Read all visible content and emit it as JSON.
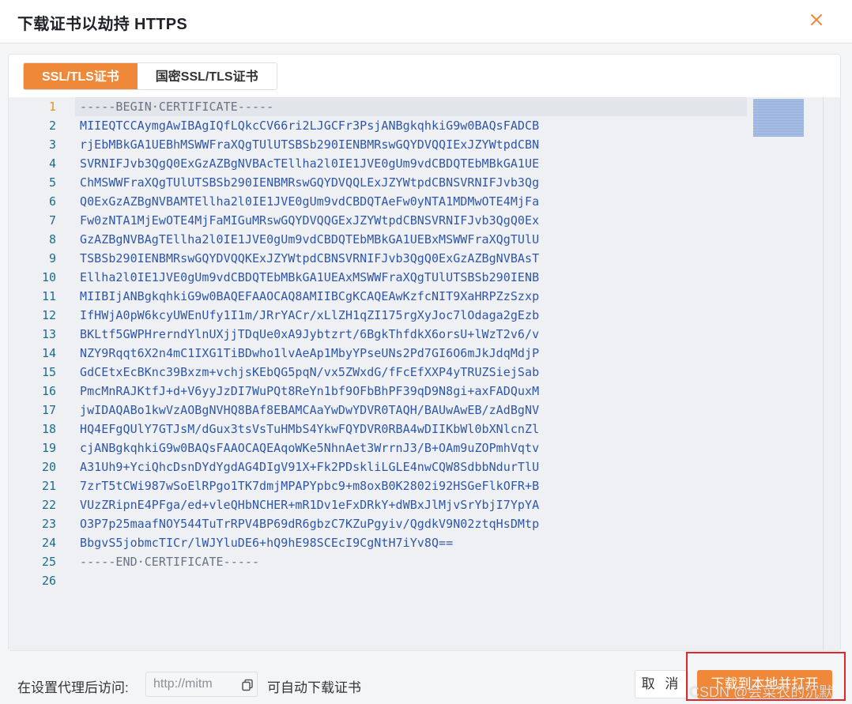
{
  "dialog": {
    "title": "下载证书以劫持 HTTPS",
    "close_icon": "close-icon"
  },
  "tabs": [
    {
      "label": "SSL/TLS证书",
      "active": true
    },
    {
      "label": "国密SSL/TLS证书",
      "active": false
    }
  ],
  "editor": {
    "active_line": 1,
    "lines": [
      {
        "n": "1",
        "text": "-----BEGIN·CERTIFICATE-----"
      },
      {
        "n": "2",
        "text": "MIIEQTCCAymgAwIBAgIQfLQkcCV66ri2LJGCFr3PsjANBgkqhkiG9w0BAQsFADCB"
      },
      {
        "n": "3",
        "text": "rjEbMBkGA1UEBhMSWWFraXQgTUlUTSBSb290IENBMRswGQYDVQQIExJZYWtpdCBN"
      },
      {
        "n": "4",
        "text": "SVRNIFJvb3QgQ0ExGzAZBgNVBAcTEllha2l0IE1JVE0gUm9vdCBDQTEbMBkGA1UE"
      },
      {
        "n": "5",
        "text": "ChMSWWFraXQgTUlUTSBSb290IENBMRswGQYDVQQLExJZYWtpdCBNSVRNIFJvb3Qg"
      },
      {
        "n": "6",
        "text": "Q0ExGzAZBgNVBAMTEllha2l0IE1JVE0gUm9vdCBDQTAeFw0yNTA1MDMwOTE4MjFa"
      },
      {
        "n": "7",
        "text": "Fw0zNTA1MjEwOTE4MjFaMIGuMRswGQYDVQQGExJZYWtpdCBNSVRNIFJvb3QgQ0Ex"
      },
      {
        "n": "8",
        "text": "GzAZBgNVBAgTEllha2l0IE1JVE0gUm9vdCBDQTEbMBkGA1UEBxMSWWFraXQgTUlU"
      },
      {
        "n": "9",
        "text": "TSBSb290IENBMRswGQYDVQQKExJZYWtpdCBNSVRNIFJvb3QgQ0ExGzAZBgNVBAsT"
      },
      {
        "n": "10",
        "text": "Ellha2l0IE1JVE0gUm9vdCBDQTEbMBkGA1UEAxMSWWFraXQgTUlUTSBSb290IENB"
      },
      {
        "n": "11",
        "text": "MIIBIjANBgkqhkiG9w0BAQEFAAOCAQ8AMIIBCgKCAQEAwKzfcNIT9XaHRPZzSzxp"
      },
      {
        "n": "12",
        "text": "IfHWjA0pW6kcyUWEnUfy1I1m/JRrYACr/xLlZH1qZI175rgXyJoc7lOdaga2gEzb"
      },
      {
        "n": "13",
        "text": "BKLtf5GWPHrerndYlnUXjjTDqUe0xA9Jybtzrt/6BgkThfdkX6orsU+lWzT2v6/v"
      },
      {
        "n": "14",
        "text": "NZY9Rqqt6X2n4mC1IXG1TiBDwho1lvAeAp1MbyYPseUNs2Pd7GI6O6mJkJdqMdjP"
      },
      {
        "n": "15",
        "text": "GdCEtxEcBKnc39Bxzm+vchjsKEbQG5pqN/vx5ZWxdG/fFcEfXXP4yTRUZSiejSab"
      },
      {
        "n": "16",
        "text": "PmcMnRAJKtfJ+d+V6yyJzDI7WuPQt8ReYn1bf9OFbBhPF39qD9N8gi+axFADQuxM"
      },
      {
        "n": "17",
        "text": "jwIDAQABo1kwVzAOBgNVHQ8BAf8EBAMCAaYwDwYDVR0TAQH/BAUwAwEB/zAdBgNV"
      },
      {
        "n": "18",
        "text": "HQ4EFgQUlY7GTJsM/dGux3tsVsTuHMbS4YkwFQYDVR0RBA4wDIIKbWl0bXNlcnZl"
      },
      {
        "n": "19",
        "text": "cjANBgkqhkiG9w0BAQsFAAOCAQEAqoWKe5NhnAet3WrrnJ3/B+OAm9uZOPmhVqtv"
      },
      {
        "n": "20",
        "text": "A31Uh9+YciQhcDsnDYdYgdAG4DIgV91X+Fk2PDskliLGLE4nwCQW8SdbbNdurTlU"
      },
      {
        "n": "21",
        "text": "7zrT5tCWi987wSoElRPgo1TK7dmjMPAPYpbc9+m8oxB0K2802i92HSGeFlkOFR+B"
      },
      {
        "n": "22",
        "text": "VUzZRipnE4PFga/ed+vleQHbNCHER+mR1Dv1eFxDRkY+dWBxJlMjvSrYbjI7YpYA"
      },
      {
        "n": "23",
        "text": "O3P7p25maafNOY544TuTrRPV4BP69dR6gbzC7KZuPgyiv/QgdkV9N02ztqHsDMtp"
      },
      {
        "n": "24",
        "text": "BbgvS5jobmcTICr/lWJYluDE6+hQ9hE98SCEcI9CgNtH7iYv8Q=="
      },
      {
        "n": "25",
        "text": "-----END·CERTIFICATE-----"
      },
      {
        "n": "26",
        "text": ""
      }
    ]
  },
  "footer": {
    "prefix_label": "在设置代理后访问:",
    "url_value": "http://mitm",
    "copy_icon": "copy-icon",
    "suffix_label": "可自动下载证书",
    "cancel_label": "取 消",
    "primary_label": "下载到本地并打开"
  },
  "watermark": "CSDN @会菜农的沉默",
  "colors": {
    "accent": "#f0883a",
    "line_number": "#1b6e8c",
    "active_line_number": "#e8922e",
    "code_text": "#2f57a8",
    "annotation_box": "#e0262b"
  }
}
